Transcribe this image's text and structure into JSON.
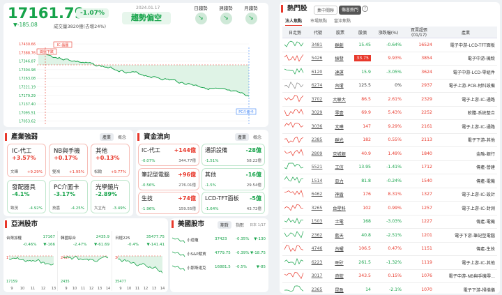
{
  "header": {
    "index": "17161.79",
    "change_pct": "-1.07%",
    "change_pts": "▼-185.08",
    "volume": "成交量3820億(去增24%)",
    "date": "2024.01.17",
    "trend": "趨勢偏空",
    "buttons": [
      "日趨勢",
      "週趨勢",
      "月趨勢"
    ]
  },
  "intraday": {
    "yticks": [
      "17430.66",
      "17388.76",
      "17346.87",
      "17304.98",
      "17263.08",
      "17221.19",
      "17179.29",
      "17137.40",
      "17095.51",
      "17053.62"
    ],
    "xticks": [
      "09:00",
      "10:00",
      "11:00",
      "12:00",
      "13:00"
    ],
    "high_label": "IC-晶圓",
    "open_label": "開盤下跌",
    "low_label": "PC介面卡"
  },
  "industry": {
    "title": "產業強弱",
    "tabs": [
      "產業",
      "概念"
    ],
    "boxes": [
      {
        "name": "IC-代工",
        "pct": "+3.57%",
        "l1": "文曄",
        "l2": "+9.29%",
        "c": "r"
      },
      {
        "name": "NB與手機",
        "pct": "+0.17%",
        "l1": "雙鴻",
        "l2": "+1.95%",
        "c": "r"
      },
      {
        "name": "其他",
        "pct": "+0.13%",
        "l1": "松翰",
        "l2": "+9.77%",
        "c": "r"
      },
      {
        "name": "發配器具",
        "pct": "-4.1%",
        "l1": "致茂",
        "l2": "-4.92%",
        "c": "g"
      },
      {
        "name": "PC介面卡",
        "pct": "-3.17%",
        "l1": "技嘉",
        "l2": "-4.25%",
        "c": "g"
      },
      {
        "name": "光學鏡片",
        "pct": "-2.89%",
        "l1": "大立光",
        "l2": "-3.49%",
        "c": "g"
      }
    ]
  },
  "capital": {
    "title": "資金流向",
    "tabs": [
      "產業",
      "概念"
    ],
    "boxes": [
      {
        "name": "IC-代工",
        "amt": "+144億",
        "pct": "-0.07%",
        "sub": "344.77億",
        "c": "r"
      },
      {
        "name": "通訊設備",
        "amt": "-28億",
        "pct": "-1.51%",
        "sub": "58.22億",
        "c": "g"
      },
      {
        "name": "筆記型電腦",
        "amt": "+96億",
        "pct": "-0.56%",
        "sub": "276.01億",
        "c": "r"
      },
      {
        "name": "其他",
        "amt": "-16億",
        "pct": "-1.5%",
        "sub": "29.54億",
        "c": "g"
      },
      {
        "name": "生技",
        "amt": "+74億",
        "pct": "-1.96%",
        "sub": "159.55億",
        "c": "r"
      },
      {
        "name": "LCD-TFT面板",
        "amt": "-5億",
        "pct": "-1.64%",
        "sub": "43.72億",
        "c": "g"
      }
    ]
  },
  "asia": {
    "title": "亞洲股市",
    "charts": [
      {
        "name": "台灣加權",
        "value": "17167",
        "pct": "-0.46%",
        "chg": "▼-166",
        "top": "17244",
        "bot": "17159",
        "ticks": [
          "9",
          "10",
          "11",
          "12",
          "13"
        ]
      },
      {
        "name": "韓國綜合",
        "value": "2435.9",
        "pct": "-2.47%",
        "chg": "▼-61.69",
        "top": "2497",
        "bot": "2435",
        "ticks": [
          "9",
          "10",
          "11",
          "12",
          "13",
          "14"
        ]
      },
      {
        "name": "日經225",
        "value": "35477.75",
        "pct": "-0.4%",
        "chg": "▼-141.41",
        "top": "36239",
        "bot": "35477",
        "ticks": [
          "9",
          "10",
          "11",
          "12",
          "13",
          "14"
        ]
      }
    ]
  },
  "us": {
    "title": "美國股市",
    "tabs": [
      "期貨",
      "指數"
    ],
    "time": "日本 1/17",
    "rows": [
      {
        "name": "小道瓊",
        "value": "37423",
        "pct": "-0.35%",
        "chg": "▼-130"
      },
      {
        "name": "小S&P期貨",
        "value": "4779.75",
        "pct": "-0.39%",
        "chg": "▼-18.75"
      },
      {
        "name": "小那斯達克",
        "value": "16881.5",
        "pct": "-0.5%",
        "chg": "▼-85"
      }
    ]
  },
  "hot": {
    "title": "熱門股",
    "tabs": [
      "集中關聯",
      "傷害熱門"
    ],
    "subtabs": [
      "法人焦點",
      "市場焦點",
      "當沖焦點"
    ],
    "headers": [
      "日走勢",
      "代號",
      "股票",
      "股價",
      "漲跌幅(%)",
      "買賣超張 (01/17)",
      "產業"
    ],
    "rows": [
      [
        "3481",
        "群創",
        "15.45",
        "-0.64%",
        "16524",
        "電子中游-LCD-TFT面板",
        "g"
      ],
      [
        "5426",
        "振發",
        "33.75",
        "9.93%",
        "3854",
        "電子中游-機殼",
        "limit"
      ],
      [
        "6120",
        "達運",
        "15.9",
        "-3.05%",
        "3624",
        "電子中游-LCD-零組件",
        "g"
      ],
      [
        "6274",
        "台燿",
        "125.5",
        "0%",
        "2937",
        "電子上游-PCB-材料設備",
        "n"
      ],
      [
        "3702",
        "大聯大",
        "86.5",
        "2.61%",
        "2329",
        "電子上游-IC-通路",
        "r"
      ],
      [
        "3029",
        "零壹",
        "69.9",
        "5.43%",
        "2252",
        "軟體-系統整合",
        "r"
      ],
      [
        "3036",
        "文曄",
        "147",
        "9.29%",
        "2161",
        "電子上游-IC-通路",
        "r"
      ],
      [
        "2385",
        "群光",
        "182",
        "0.55%",
        "2113",
        "電子下游-其他",
        "r"
      ],
      [
        "2809",
        "京城銀",
        "40.9",
        "1.49%",
        "1840",
        "金融-銀行",
        "r"
      ],
      [
        "5521",
        "工信",
        "13.95",
        "-1.41%",
        "1712",
        "傳產-營建",
        "g"
      ],
      [
        "1514",
        "亞力",
        "81.8",
        "-0.24%",
        "1540",
        "傳產-電機",
        "g"
      ],
      [
        "6462",
        "神盾",
        "176",
        "8.31%",
        "1327",
        "電子上游-IC-設計",
        "r"
      ],
      [
        "3265",
        "台星科",
        "102",
        "0.99%",
        "1257",
        "電子上游-IC-封測",
        "r"
      ],
      [
        "1503",
        "士電",
        "168",
        "-3.03%",
        "1227",
        "傳產-電機",
        "g"
      ],
      [
        "2362",
        "藍天",
        "40.8",
        "-2.51%",
        "1201",
        "電子下游-筆記型電腦",
        "g"
      ],
      [
        "4746",
        "台耀",
        "106.5",
        "0.47%",
        "1151",
        "傳產-生技",
        "r"
      ],
      [
        "6223",
        "旺矽",
        "261.5",
        "-1.32%",
        "1119",
        "電子上游-IC-其他",
        "g"
      ],
      [
        "3017",
        "奇鋐",
        "343.5",
        "0.15%",
        "1076",
        "電子中游-NB與手機零...",
        "r"
      ],
      [
        "2365",
        "昆盈",
        "14",
        "-2.1%",
        "1070",
        "電子下游-掃描儀",
        "g"
      ]
    ]
  }
}
